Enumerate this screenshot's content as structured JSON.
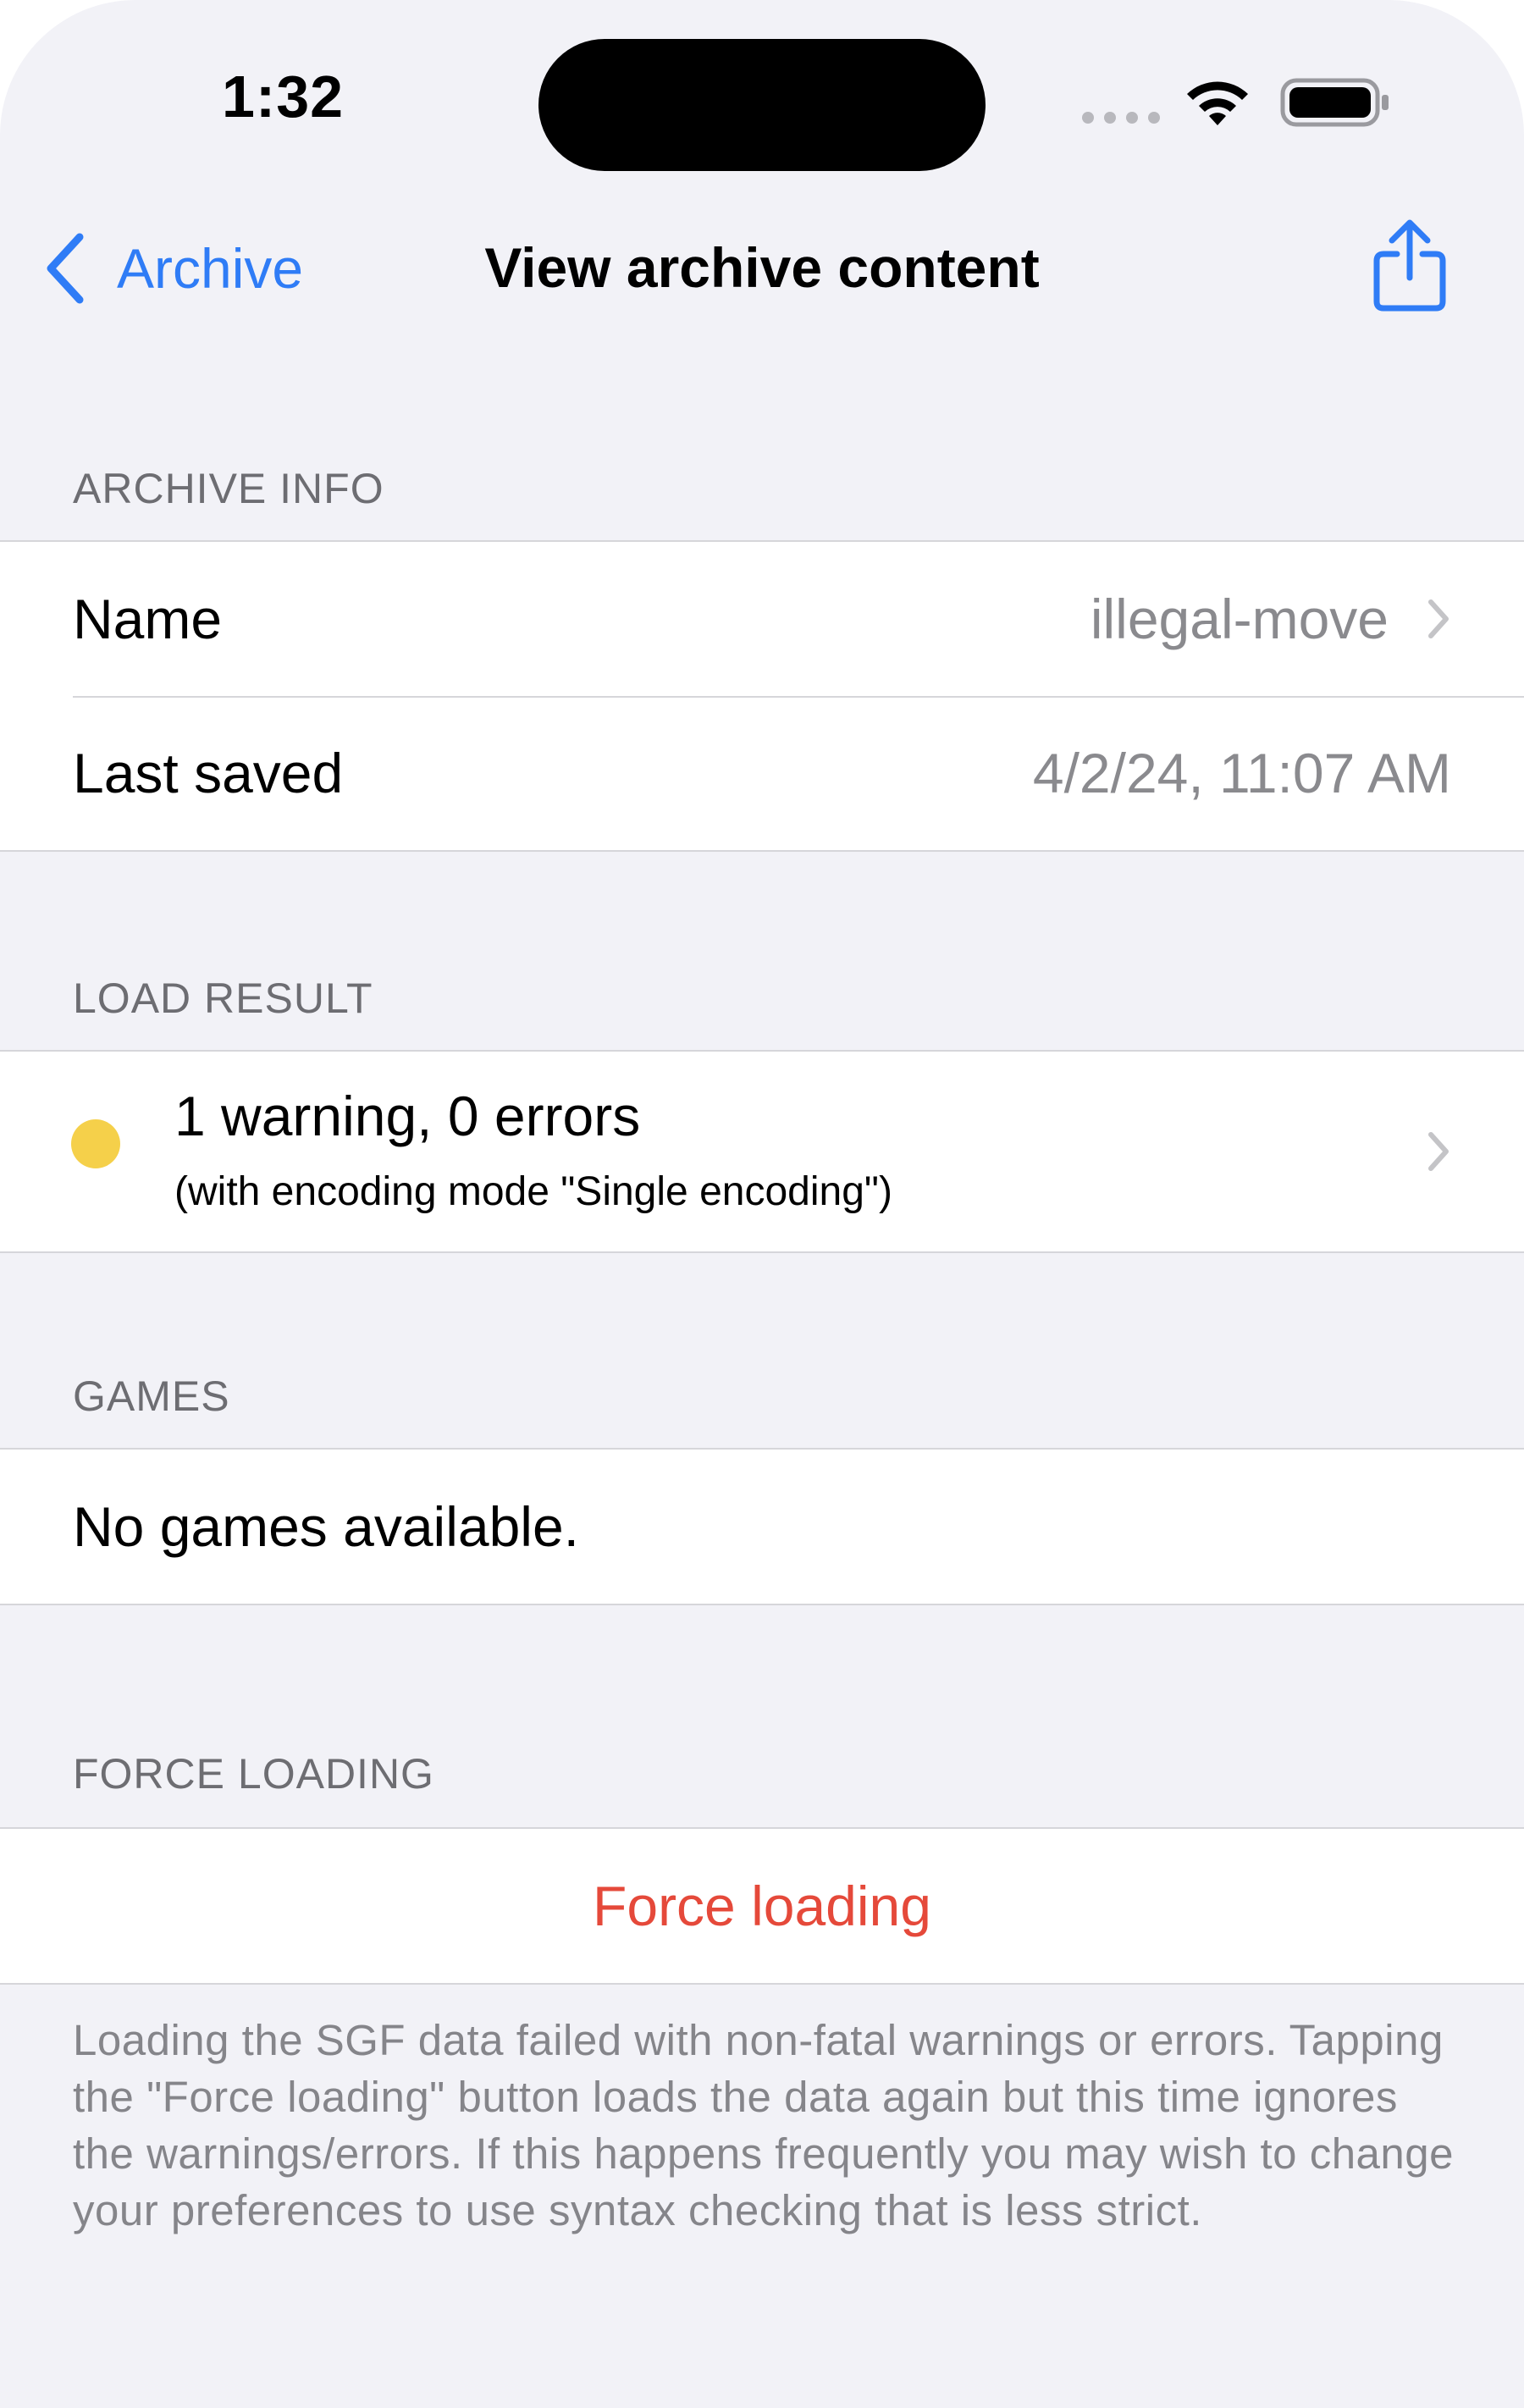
{
  "status_bar": {
    "time": "1:32"
  },
  "nav": {
    "back_label": "Archive",
    "title": "View archive content",
    "share_icon": "share-icon"
  },
  "archive_info": {
    "header": "ARCHIVE INFO",
    "rows": [
      {
        "label": "Name",
        "value": "illegal-move"
      },
      {
        "label": "Last saved",
        "value": "4/2/24, 11:07 AM"
      }
    ]
  },
  "load_result": {
    "header": "LOAD RESULT",
    "title": "1 warning, 0 errors",
    "subtitle": "(with encoding mode \"Single encoding\")",
    "status_color": "#f5d04a"
  },
  "games": {
    "header": "GAMES",
    "empty_text": "No games available."
  },
  "force_loading": {
    "header": "FORCE LOADING",
    "button_label": "Force loading",
    "button_color": "#e5493a",
    "footer": "Loading the SGF data failed with non-fatal warnings or errors. Tapping the \"Force loading\" button loads the data again but this time ignores the warnings/errors. If this happens frequently you may wish to change your preferences to use syntax checking that is less strict."
  },
  "colors": {
    "accent": "#2f7cf6",
    "background": "#f2f2f7"
  }
}
